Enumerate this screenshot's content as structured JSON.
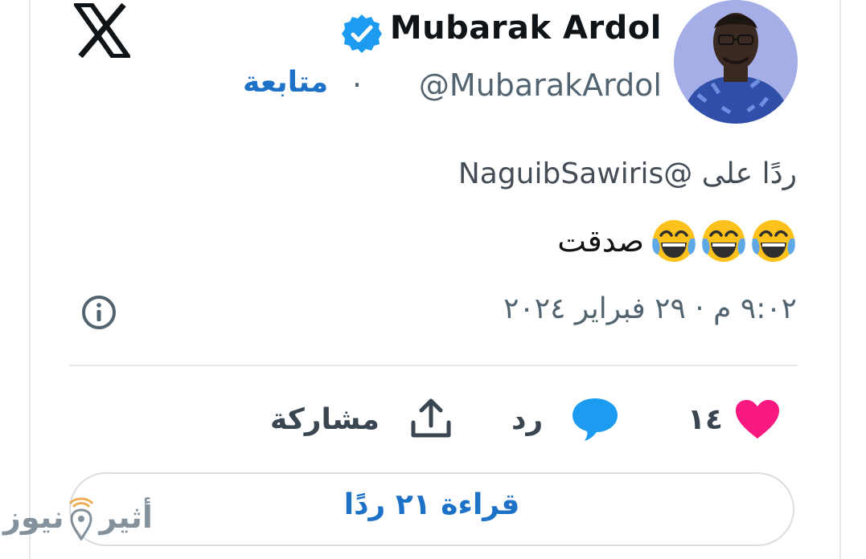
{
  "platform": {
    "logo_icon": "x-logo-icon"
  },
  "author": {
    "display_name": "Mubarak Ardol",
    "handle": "@MubarakArdol",
    "verified_icon": "verified-badge-icon",
    "follow_label": "متابعة",
    "separator": "·"
  },
  "tweet": {
    "reply_to": "ردًا على @NaguibSawiris",
    "text": "صدقت",
    "emoji": [
      "face-with-tears-of-joy-icon",
      "face-with-tears-of-joy-icon",
      "face-with-tears-of-joy-icon"
    ],
    "timestamp": "٩:٠٢ م · ٢٩ فبراير ٢٠٢٤",
    "info_icon": "info-icon"
  },
  "actions": {
    "like_count": "١٤",
    "reply_label": "رد",
    "share_label": "مشاركة"
  },
  "read_replies_label": "قراءة ٢١ ردًا",
  "watermark": {
    "text_right": "أثير",
    "text_left": "نيوز"
  },
  "colors": {
    "accent_blue": "#1d9bf0",
    "link_blue": "#1d72c8",
    "like_pink": "#f91880",
    "text_primary": "#0f1419",
    "text_secondary": "#536471"
  }
}
